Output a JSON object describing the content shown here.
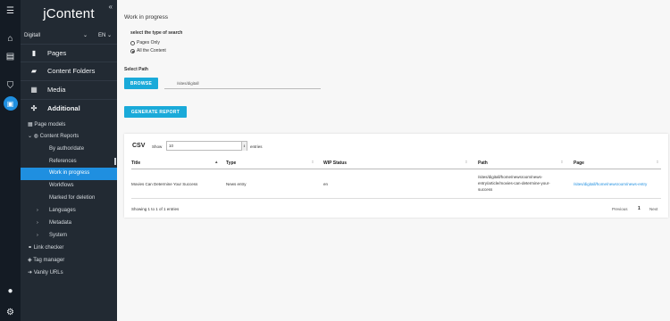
{
  "rail": {
    "icons": [
      "menu-icon",
      "home-icon",
      "clipboard-icon",
      "shield-icon",
      "content-editor-icon",
      "user-icon",
      "gear-icon"
    ]
  },
  "sidebar": {
    "logo": "jContent",
    "collapse": "«",
    "site": "Digitall",
    "lang": "EN",
    "main_items": [
      {
        "label": "Pages",
        "icon": "page-icon"
      },
      {
        "label": "Content Folders",
        "icon": "folder-icon"
      },
      {
        "label": "Media",
        "icon": "media-icon"
      },
      {
        "label": "Additional",
        "icon": "puzzle-icon"
      }
    ],
    "sub_items": [
      "Page models",
      "Content Reports",
      "By author/date",
      "References",
      "Work in progress",
      "Workflows",
      "Marked for deletion",
      "Languages",
      "Metadata",
      "System",
      "Link checker",
      "Tag manager",
      "Vanity URLs"
    ],
    "active_sub": "Work in progress"
  },
  "main": {
    "title": "Work in progress",
    "search_type_label": "select the type of search",
    "radio_options": [
      "Pages Only",
      "All the Content"
    ],
    "selected_radio": "All the Content",
    "path_label": "Select Path",
    "browse_label": "BROWSE",
    "path_value": "/sites/digitall",
    "generate_label": "GENERATE REPORT"
  },
  "table": {
    "csv_label": "CSV",
    "show_label": "Show",
    "show_value": "10",
    "entries_label": "entries",
    "columns": [
      "Title",
      "Type",
      "WIP Status",
      "Path",
      "Page"
    ],
    "rows": [
      {
        "title": "Movies Can Determine Your Success",
        "type": "News entry",
        "wip_status": "en",
        "path_line1": "/sites/digitall/home/newsroom/news-",
        "path_line2": "entry/article/movies-can-determine-your-",
        "path_line3": "success",
        "page": "/sites/digitall/home/newsroom/news-entry"
      }
    ],
    "info": "Showing 1 to 1 of 1 entries",
    "prev": "Previous",
    "page_num": "1",
    "next": "Next"
  }
}
